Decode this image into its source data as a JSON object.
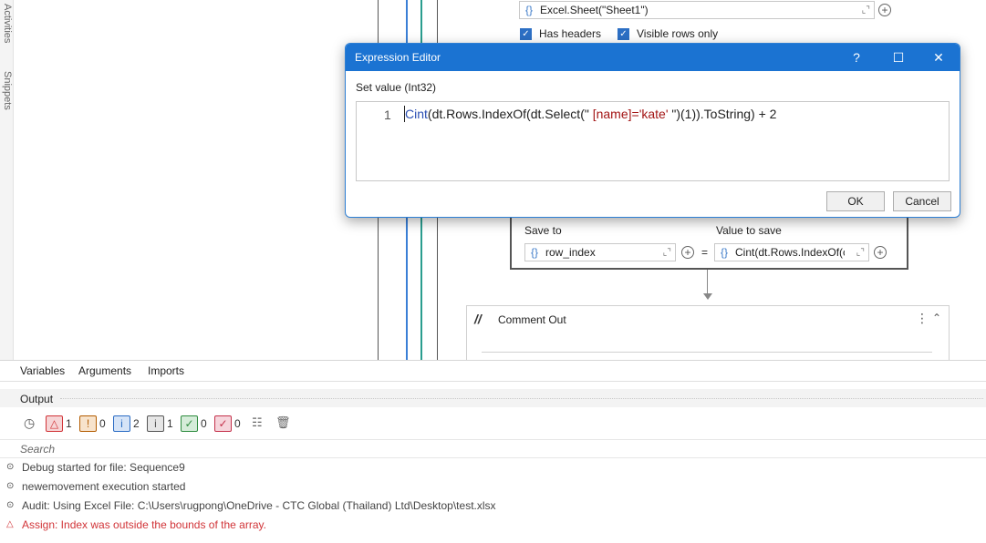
{
  "side_strip": {
    "activities_label": "Activities",
    "snippets_label": "Snippets"
  },
  "canvas": {
    "excel_sheet_value": "Excel.Sheet(\"Sheet1\")",
    "has_headers_label": "Has headers",
    "visible_rows_label": "Visible rows only",
    "assign": {
      "save_to_label": "Save to",
      "value_to_save_label": "Value to save",
      "save_to_value": "row_index",
      "value_to_save_value": "Cint(dt.Rows.IndexOf(c",
      "equals": "="
    },
    "comment_out": {
      "title": "Comment Out"
    },
    "icons": {
      "curly": "{}",
      "expand": "⌞⌝",
      "plus": "+",
      "menu": "⋮",
      "collapse": "⌃"
    }
  },
  "dialog": {
    "title": "Expression Editor",
    "help": "?",
    "maximize": "☐",
    "close": "✕",
    "set_value_label": "Set value (Int32)",
    "line_number": "1",
    "code_keyword": "Cint",
    "code_before": "(dt.Rows.IndexOf(dt.Select(\"",
    "code_string": " [name]='kate' ",
    "code_after": "\")(1)).ToString) + 2",
    "ok": "OK",
    "cancel": "Cancel"
  },
  "bottom_panel": {
    "tabs": [
      "Variables",
      "Arguments",
      "Imports"
    ],
    "output_title": "Output",
    "badges": [
      {
        "glyph": "△",
        "count": "1",
        "color": "#d13438",
        "bg": "#f6d5d6"
      },
      {
        "glyph": "!",
        "count": "0",
        "color": "#b35c00",
        "bg": "#f7e3cc"
      },
      {
        "glyph": "i",
        "count": "2",
        "color": "#2b6cc4",
        "bg": "#d6e4f7"
      },
      {
        "glyph": "i",
        "count": "1",
        "color": "#555555",
        "bg": "#e6e6e6"
      },
      {
        "glyph": "✓",
        "count": "0",
        "color": "#2e8b3e",
        "bg": "#d5ecd9"
      },
      {
        "glyph": "✓",
        "count": "0",
        "color": "#c4314b",
        "bg": "#f6d5dc"
      }
    ],
    "search_placeholder": "Search",
    "logs": [
      {
        "icon": "⊙",
        "text": "Debug started for file: Sequence9",
        "color": "#444444"
      },
      {
        "icon": "⊙",
        "text": "newemovement execution started",
        "color": "#444444"
      },
      {
        "icon": "⊙",
        "text": "Audit: Using Excel File: C:\\Users\\rugpong\\OneDrive - CTC Global (Thailand) Ltd\\Desktop\\test.xlsx",
        "color": "#444444"
      },
      {
        "icon": "△",
        "text": "Assign: Index was outside the bounds of the array.",
        "color": "#d13438"
      }
    ]
  }
}
